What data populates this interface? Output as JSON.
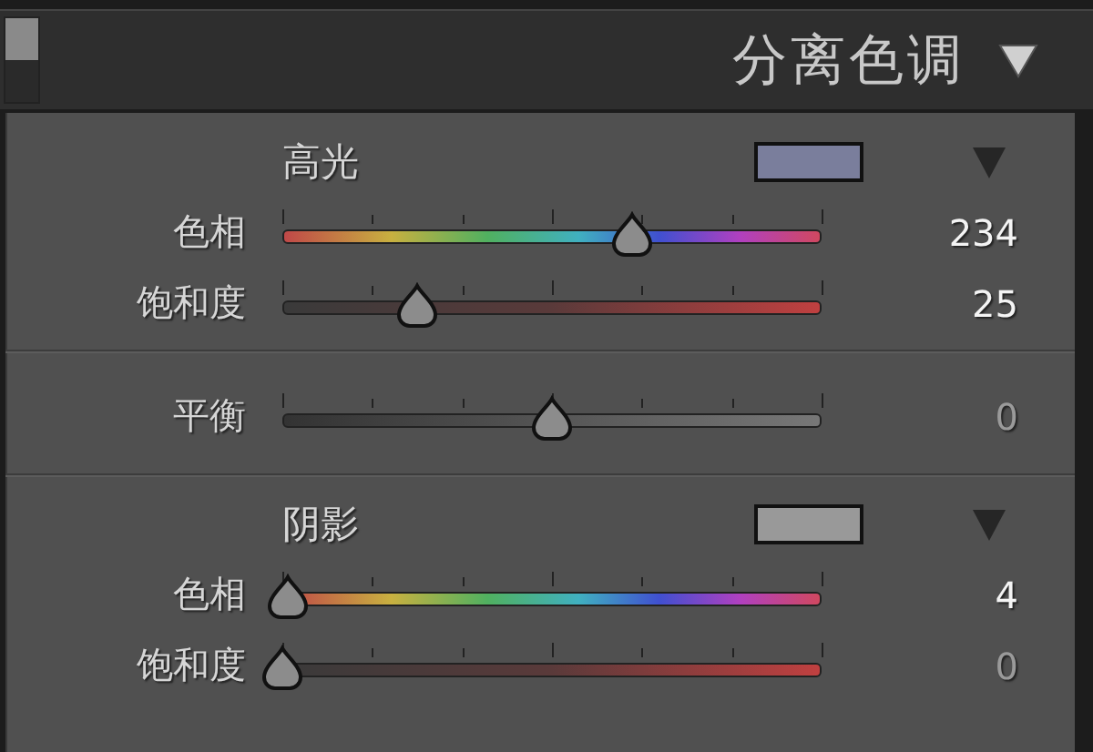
{
  "panel": {
    "title": "分离色调",
    "enabled": true
  },
  "groups": [
    {
      "kind": "tone",
      "heading": "高光",
      "color": "#7a7e9c",
      "sliders": [
        {
          "label": "色相",
          "kind": "hue",
          "level": 0.65,
          "value": "234",
          "modified": true
        },
        {
          "label": "饱和度",
          "kind": "saturation",
          "level": 0.25,
          "value": "25",
          "modified": true
        }
      ]
    },
    {
      "kind": "plain",
      "sliders": [
        {
          "label": "平衡",
          "kind": "balance",
          "level": 0.5,
          "value": "0",
          "modified": false
        }
      ]
    },
    {
      "kind": "tone",
      "heading": "阴影",
      "color": "#999999",
      "sliders": [
        {
          "label": "色相",
          "kind": "hue",
          "level": 0.01,
          "value": "4",
          "modified": true
        },
        {
          "label": "饱和度",
          "kind": "saturation",
          "level": 0,
          "value": "0",
          "modified": false
        }
      ]
    }
  ]
}
